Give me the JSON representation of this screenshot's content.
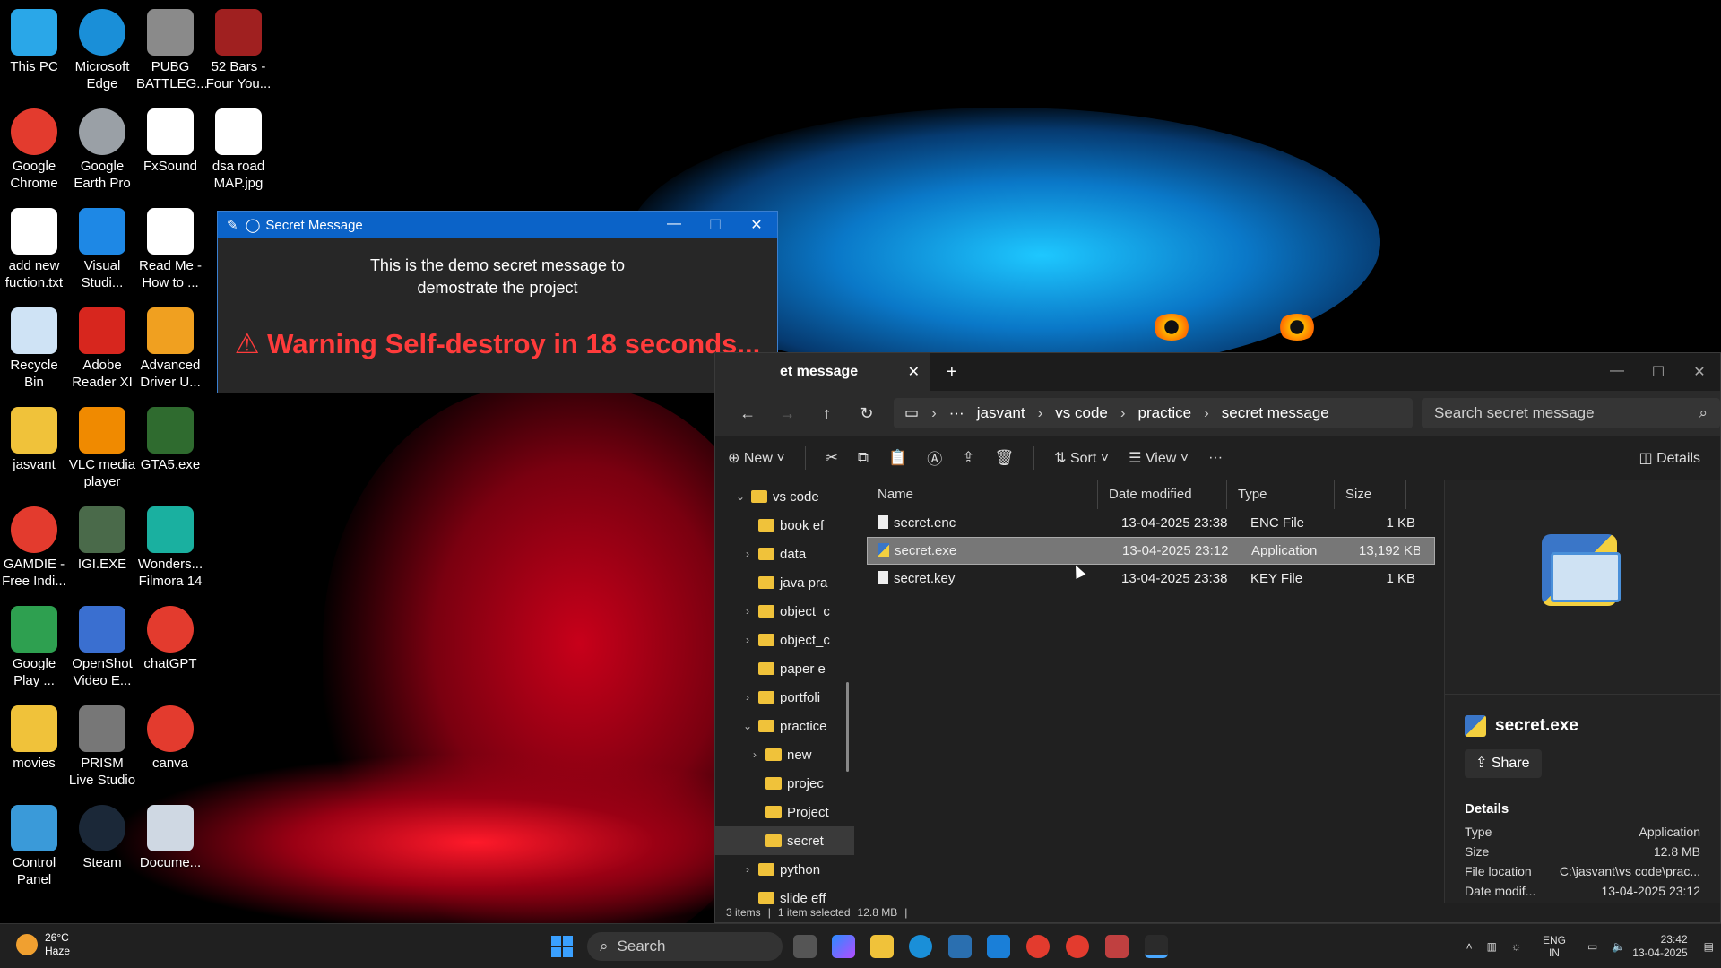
{
  "desktop_icons": [
    {
      "label": "This PC",
      "icon": "pc-icon",
      "color": "#2aa7e8"
    },
    {
      "label": "Microsoft Edge",
      "icon": "edge-icon",
      "color": "#1a8fd8"
    },
    {
      "label": "PUBG BATTLEG...",
      "icon": "pubg-icon",
      "color": "#8a8a8a"
    },
    {
      "label": "52 Bars - Four You...",
      "icon": "album-icon",
      "color": "#a02020"
    },
    {
      "label": "Google Chrome",
      "icon": "chrome-icon",
      "color": "#e33b2e"
    },
    {
      "label": "Google Earth Pro",
      "icon": "earth-icon",
      "color": "#9aa0a6"
    },
    {
      "label": "FxSound",
      "icon": "fxsound-icon",
      "color": "#ffffff"
    },
    {
      "label": "dsa road MAP.jpg",
      "icon": "image-file-icon",
      "color": "#ffffff"
    },
    {
      "label": "add new fuction.txt",
      "icon": "text-file-icon",
      "color": "#ffffff"
    },
    {
      "label": "Visual Studi...",
      "icon": "vscode-icon",
      "color": "#1e88e5"
    },
    {
      "label": "Read Me - How to ...",
      "icon": "text-file-icon",
      "color": "#ffffff"
    },
    {
      "label": "Recycle Bin",
      "icon": "recycle-bin-icon",
      "color": "#cfe3f5"
    },
    {
      "label": "Adobe Reader XI",
      "icon": "adobe-reader-icon",
      "color": "#d7261e"
    },
    {
      "label": "Advanced Driver U...",
      "icon": "driver-updater-icon",
      "color": "#f0a020"
    },
    {
      "label": "jasvant",
      "icon": "folder-icon",
      "color": "#f0c23a"
    },
    {
      "label": "VLC media player",
      "icon": "vlc-icon",
      "color": "#f08a00"
    },
    {
      "label": "GTA5.exe",
      "icon": "gta-icon",
      "color": "#2f6b2f"
    },
    {
      "label": "GAMDIE - Free Indi...",
      "icon": "chrome-icon",
      "color": "#e33b2e"
    },
    {
      "label": "IGI.EXE",
      "icon": "igi-icon",
      "color": "#4a6a4a"
    },
    {
      "label": "Wonders... Filmora 14",
      "icon": "filmora-icon",
      "color": "#1ab0a0"
    },
    {
      "label": "Google Play ...",
      "icon": "google-play-icon",
      "color": "#2ea050"
    },
    {
      "label": "OpenShot Video E...",
      "icon": "openshot-icon",
      "color": "#3a6fd0"
    },
    {
      "label": "chatGPT",
      "icon": "chrome-icon",
      "color": "#e33b2e"
    },
    {
      "label": "movies",
      "icon": "folder-icon",
      "color": "#f0c23a"
    },
    {
      "label": "PRISM Live Studio",
      "icon": "prism-icon",
      "color": "#777777"
    },
    {
      "label": "canva",
      "icon": "chrome-icon",
      "color": "#e33b2e"
    },
    {
      "label": "Control Panel",
      "icon": "control-panel-icon",
      "color": "#3a9ad9"
    },
    {
      "label": "Steam",
      "icon": "steam-icon",
      "color": "#1b2838"
    },
    {
      "label": "Docume...",
      "icon": "documents-folder-icon",
      "color": "#cfd8e3"
    }
  ],
  "secret_window": {
    "title": "Secret Message",
    "message_line1": "This is the demo secret message to",
    "message_line2": "demostrate the project",
    "warning": "Warning Self-destroy in 18 seconds...",
    "warning_color": "#ff3b3b",
    "titlebar_color": "#0b63c8"
  },
  "explorer": {
    "tab_label": "et message",
    "breadcrumb": [
      "jasvant",
      "vs code",
      "practice",
      "secret message"
    ],
    "search_placeholder": "Search secret message",
    "commands": {
      "new": "New",
      "sort": "Sort",
      "view": "View",
      "details": "Details"
    },
    "tree": [
      {
        "label": "vs code",
        "chevron": "⌄",
        "indent": 0
      },
      {
        "label": "book ef",
        "chevron": "",
        "indent": 1
      },
      {
        "label": "data",
        "chevron": "›",
        "indent": 1
      },
      {
        "label": "java pra",
        "chevron": "",
        "indent": 1
      },
      {
        "label": "object_c",
        "chevron": "›",
        "indent": 1
      },
      {
        "label": "object_c",
        "chevron": "›",
        "indent": 1
      },
      {
        "label": "paper e",
        "chevron": "",
        "indent": 1
      },
      {
        "label": "portfoli",
        "chevron": "›",
        "indent": 1
      },
      {
        "label": "practice",
        "chevron": "⌄",
        "indent": 1
      },
      {
        "label": "new",
        "chevron": "›",
        "indent": 2
      },
      {
        "label": "projec",
        "chevron": "",
        "indent": 2
      },
      {
        "label": "Project",
        "chevron": "",
        "indent": 2
      },
      {
        "label": "secret",
        "chevron": "",
        "indent": 2,
        "selected": true
      },
      {
        "label": "python",
        "chevron": "›",
        "indent": 1
      },
      {
        "label": "slide eff",
        "chevron": "",
        "indent": 1
      }
    ],
    "columns": {
      "name": "Name",
      "date": "Date modified",
      "type": "Type",
      "size": "Size"
    },
    "files": [
      {
        "name": "secret.enc",
        "date": "13-04-2025 23:38",
        "type": "ENC File",
        "size": "1 KB",
        "selected": false
      },
      {
        "name": "secret.exe",
        "date": "13-04-2025 23:12",
        "type": "Application",
        "size": "13,192 KB",
        "selected": true
      },
      {
        "name": "secret.key",
        "date": "13-04-2025 23:38",
        "type": "KEY File",
        "size": "1 KB",
        "selected": false
      }
    ],
    "details_pane": {
      "file_name": "secret.exe",
      "share_label": "Share",
      "section_title": "Details",
      "rows": [
        {
          "key": "Type",
          "value": "Application"
        },
        {
          "key": "Size",
          "value": "12.8 MB"
        },
        {
          "key": "File location",
          "value": "C:\\jasvant\\vs code\\prac..."
        },
        {
          "key": "Date modif...",
          "value": "13-04-2025 23:12"
        }
      ]
    },
    "status": {
      "items": "3 items",
      "selected": "1 item selected",
      "size": "12.8 MB"
    }
  },
  "taskbar": {
    "weather_temp": "26°C",
    "weather_desc": "Haze",
    "search_label": "Search",
    "lang_line1": "ENG",
    "lang_line2": "IN",
    "time": "23:42",
    "date": "13-04-2025"
  }
}
